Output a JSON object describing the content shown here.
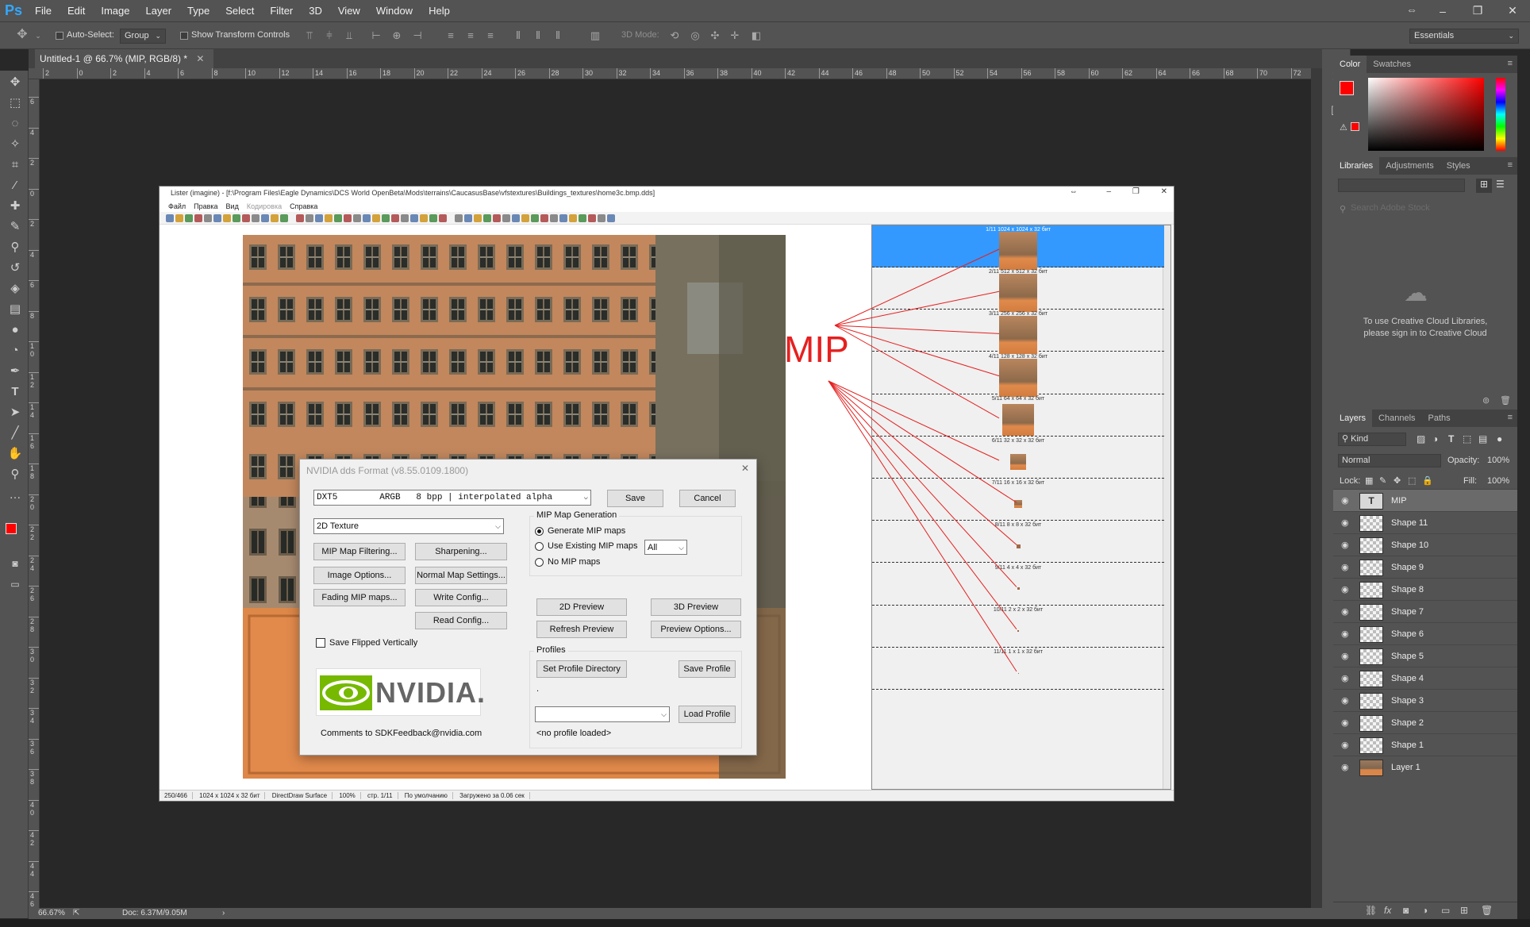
{
  "app": {
    "logo": "Ps",
    "menu": [
      "File",
      "Edit",
      "Image",
      "Layer",
      "Type",
      "Select",
      "Filter",
      "3D",
      "View",
      "Window",
      "Help"
    ]
  },
  "options_bar": {
    "auto_select_label": "Auto-Select:",
    "auto_select_value": "Group",
    "transform_label": "Show Transform Controls",
    "mode_3d_label": "3D Mode:",
    "workspace": "Essentials"
  },
  "document": {
    "tab_title": "Untitled-1 @ 66.7% (MIP, RGB/8) *",
    "zoom": "66.67%",
    "doc_size": "Doc: 6.37M/9.05M"
  },
  "ruler": {
    "h": [
      "2",
      "0",
      "2",
      "4",
      "6",
      "8",
      "10",
      "12",
      "14",
      "16",
      "18",
      "20",
      "22",
      "24",
      "26",
      "28",
      "30",
      "32",
      "34",
      "36",
      "38",
      "40",
      "42",
      "44",
      "46",
      "48",
      "50",
      "52",
      "54",
      "56",
      "58",
      "60",
      "62",
      "64",
      "66",
      "68",
      "70",
      "72",
      "74"
    ],
    "v": [
      "6",
      "4",
      "2",
      "0",
      "2",
      "4",
      "6",
      "8",
      "1 0",
      "1 2",
      "1 4",
      "1 6",
      "1 8",
      "2 0",
      "2 2",
      "2 4",
      "2 6",
      "2 8",
      "3 0",
      "3 2",
      "3 4",
      "3 6",
      "3 8",
      "4 0",
      "4 2",
      "4 4",
      "4 6"
    ]
  },
  "color_panel": {
    "tabs": [
      "Color",
      "Swatches"
    ],
    "fg": "#ff0000",
    "bg": "#ffffff"
  },
  "libraries_panel": {
    "tabs": [
      "Libraries",
      "Adjustments",
      "Styles"
    ],
    "search_placeholder": "Search Adobe Stock",
    "message_line1": "To use Creative Cloud Libraries,",
    "message_line2": "please sign in to Creative Cloud"
  },
  "layers_panel": {
    "tabs": [
      "Layers",
      "Channels",
      "Paths"
    ],
    "filter_kind": "Kind",
    "blend_mode": "Normal",
    "opacity_label": "Opacity:",
    "opacity_value": "100%",
    "lock_label": "Lock:",
    "fill_label": "Fill:",
    "fill_value": "100%",
    "layers": [
      "MIP",
      "Shape 11",
      "Shape 10",
      "Shape 9",
      "Shape 8",
      "Shape 7",
      "Shape 6",
      "Shape 5",
      "Shape 4",
      "Shape 3",
      "Shape 2",
      "Shape 1",
      "Layer 1"
    ]
  },
  "lister": {
    "title": "Lister (imagine) - [f:\\Program Files\\Eagle Dynamics\\DCS World OpenBeta\\Mods\\terrains\\CaucasusBase\\vfstextures\\Buildings_textures\\home3c.bmp.dds]",
    "menu": [
      "Файл",
      "Правка",
      "Вид",
      "Кодировка",
      "Справка"
    ],
    "status": [
      "250/466",
      "1024 x 1024 x 32 бит",
      "DirectDraw Surface",
      "100%",
      "стр. 1/11",
      "По умолчанию",
      "Загружено за 0.06 сек"
    ],
    "mips": [
      "1/11    1024 x 1024 x 32 бит",
      "2/11    512 x 512 x 32 бит",
      "3/11    256 x 256 x 32 бит",
      "4/11    128 x 128 x 32 бит",
      "5/11    64 x 64 x 32 бит",
      "6/11    32 x 32 x 32 бит",
      "7/11    16 x 16 x 32 бит",
      "8/11    8 x 8 x 32 бит",
      "9/11    4 x 4 x 32 бит",
      "10/11    2 x 2 x 32 бит",
      "11/11    1 x 1 x 32 бит"
    ]
  },
  "annotation": {
    "mip_label": "MIP"
  },
  "nvidia_dialog": {
    "title": "NVIDIA dds Format (v8.55.0109.1800)",
    "format_value": "DXT5        ARGB   8 bpp | interpolated alpha",
    "texture_type": "2D Texture",
    "save": "Save",
    "cancel": "Cancel",
    "btn_mip_filtering": "MIP Map Filtering...",
    "btn_sharpening": "Sharpening...",
    "btn_image_options": "Image Options...",
    "btn_normal_map": "Normal Map Settings...",
    "btn_fading": "Fading MIP maps...",
    "btn_write_config": "Write Config...",
    "btn_read_config": "Read Config...",
    "save_flipped": "Save Flipped Vertically",
    "mip_group_title": "MIP Map Generation",
    "radio_generate": "Generate MIP maps",
    "radio_use_existing": "Use Existing MIP maps",
    "radio_none": "No MIP maps",
    "mip_count": "All",
    "btn_2d_preview": "2D Preview",
    "btn_3d_preview": "3D Preview",
    "btn_refresh": "Refresh Preview",
    "btn_preview_options": "Preview Options...",
    "profiles_title": "Profiles",
    "btn_set_profile_dir": "Set Profile Directory",
    "btn_save_profile": "Save Profile",
    "profile_dot": ".",
    "btn_load_profile": "Load Profile",
    "no_profile": "<no profile loaded>",
    "comments": "Comments to SDKFeedback@nvidia.com",
    "logo_text": "NVIDIA."
  }
}
